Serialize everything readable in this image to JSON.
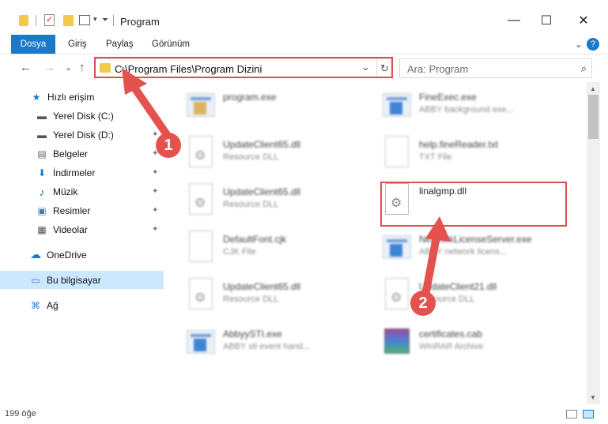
{
  "window": {
    "title": "Program",
    "minimize_glyph": "—",
    "maximize_glyph": "☐",
    "close_glyph": "✕"
  },
  "ribbon": {
    "tabs": [
      "Dosya",
      "Giriş",
      "Paylaş",
      "Görünüm"
    ],
    "expand_glyph": "⌄",
    "help_glyph": "?"
  },
  "nav": {
    "back_glyph": "←",
    "forward_glyph": "→",
    "recent_glyph": "⌄",
    "up_glyph": "↑"
  },
  "address": {
    "path": "C:\\Program Files\\Program Dizini",
    "dropdown_glyph": "⌄",
    "refresh_glyph": "↻"
  },
  "search": {
    "placeholder": "Ara: Program",
    "icon_glyph": "⌕"
  },
  "sidebar": {
    "items": [
      {
        "label": "Hızlı erişim",
        "icon": "star-icon",
        "glyph": "★"
      },
      {
        "label": "Yerel Disk (C:)",
        "icon": "drive-icon",
        "glyph": "▬"
      },
      {
        "label": "Yerel Disk (D:)",
        "icon": "drive-icon",
        "glyph": "▬"
      },
      {
        "label": "Belgeler",
        "icon": "documents-icon",
        "glyph": "▤"
      },
      {
        "label": "İndirmeler",
        "icon": "download-icon",
        "glyph": "⬇"
      },
      {
        "label": "Müzik",
        "icon": "music-icon",
        "glyph": "♪"
      },
      {
        "label": "Resimler",
        "icon": "pictures-icon",
        "glyph": "▣"
      },
      {
        "label": "Videolar",
        "icon": "video-icon",
        "glyph": "▦"
      },
      {
        "label": "OneDrive",
        "icon": "cloud-icon",
        "glyph": "☁"
      },
      {
        "label": "Bu bilgisayar",
        "icon": "computer-icon",
        "glyph": "▭"
      },
      {
        "label": "Ağ",
        "icon": "network-icon",
        "glyph": "⌘"
      }
    ],
    "pin_glyph": "✦"
  },
  "files": [
    {
      "name": "program.exe",
      "desc": "",
      "icon": "exe-icon"
    },
    {
      "name": "FineExec.exe",
      "desc": "ABBY background exe...",
      "icon": "exe-icon"
    },
    {
      "name": "UpdateClient65.dll",
      "desc": "Resource DLL",
      "icon": "dll-icon"
    },
    {
      "name": "help.fineReader.txt",
      "desc": "TXT File",
      "icon": "txt-icon"
    },
    {
      "name": "UpdateClient65.dll",
      "desc": "Resource DLL",
      "icon": "dll-icon"
    },
    {
      "name": "linalgmp.dll",
      "desc": "",
      "icon": "dll-icon"
    },
    {
      "name": "DefaultFont.cjk",
      "desc": "CJK File",
      "icon": "file-icon"
    },
    {
      "name": "NetworkLicenseServer.exe",
      "desc": "ABBY network licens...",
      "icon": "exe-icon"
    },
    {
      "name": "UpdateClient65.dll",
      "desc": "Resource DLL",
      "icon": "dll-icon"
    },
    {
      "name": "UpdateClient21.dll",
      "desc": "Resource DLL",
      "icon": "dll-icon"
    },
    {
      "name": "AbbyySTI.exe",
      "desc": "ABBY sti event hand...",
      "icon": "exe-icon"
    },
    {
      "name": "certificates.cab",
      "desc": "WinRAR Archive",
      "icon": "archive-icon"
    }
  ],
  "status": {
    "count": "199 öğe"
  },
  "annotations": {
    "step1": "1",
    "step2": "2",
    "color": "#e04e4e"
  },
  "colors": {
    "accent": "#1979ca",
    "selection": "#cce8ff"
  }
}
